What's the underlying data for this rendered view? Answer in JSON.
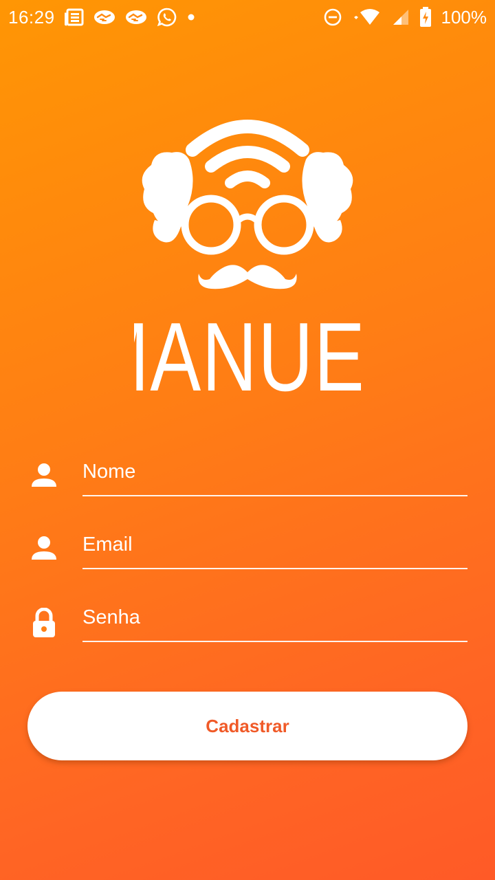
{
  "status_bar": {
    "time": "16:29",
    "battery_percent": "100%",
    "notification_icons": [
      "news-icon",
      "handshake-icon",
      "handshake-icon",
      "whatsapp-icon",
      "dot-icon"
    ],
    "system_icons": [
      "do-not-disturb-icon",
      "wifi-icon",
      "signal-icon",
      "battery-charging-icon"
    ]
  },
  "brand": {
    "name": "MANUEL",
    "logo_icon": "grandpa-wifi-logo"
  },
  "form": {
    "fields": [
      {
        "icon": "person-icon",
        "placeholder": "Nome",
        "value": ""
      },
      {
        "icon": "person-icon",
        "placeholder": "Email",
        "value": ""
      },
      {
        "icon": "lock-icon",
        "placeholder": "Senha",
        "value": ""
      }
    ],
    "submit_label": "Cadastrar"
  },
  "colors": {
    "gradient_top": "#ff9604",
    "gradient_bottom": "#ff5a27",
    "button_bg": "#ffffff",
    "button_text": "#f05a28",
    "text": "#ffffff"
  }
}
